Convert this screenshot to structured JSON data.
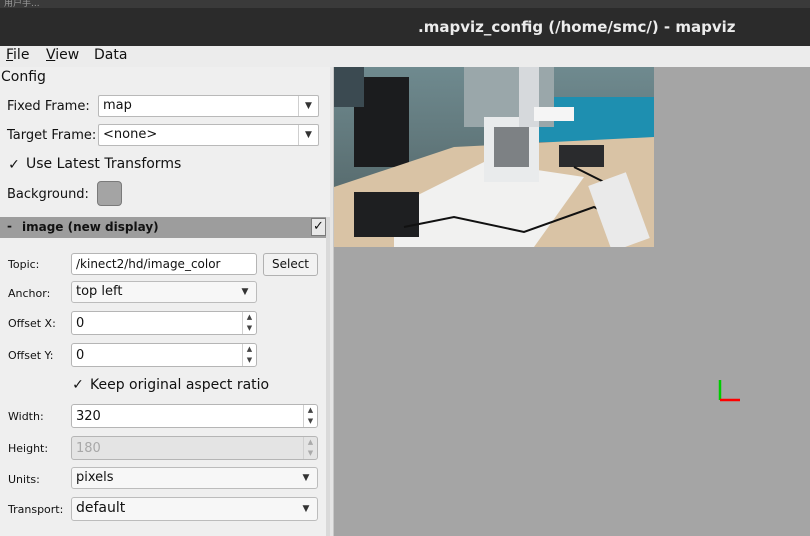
{
  "window": {
    "top_strip_text": "用户手...",
    "title": ".mapviz_config (/home/smc/) - mapviz"
  },
  "menu": [
    {
      "label": "File",
      "mnemonic": "F",
      "rest": "ile"
    },
    {
      "label": "View",
      "mnemonic": "V",
      "rest": "iew"
    },
    {
      "label": "Data",
      "mnemonic": "",
      "rest": "Data"
    }
  ],
  "config": {
    "title": "Config",
    "fixed_frame": {
      "label": "Fixed Frame:",
      "value": "map"
    },
    "target_frame": {
      "label": "Target Frame:",
      "value": "<none>"
    },
    "use_latest": {
      "label": "Use Latest Transforms",
      "checked": true
    },
    "background": {
      "label": "Background:",
      "color": "#a5a5a5"
    }
  },
  "display": {
    "dash": "-",
    "name": "image (new display)",
    "enabled": true,
    "topic": {
      "label": "Topic:",
      "value": "/kinect2/hd/image_color",
      "button": "Select"
    },
    "anchor": {
      "label": "Anchor:",
      "value": "top left"
    },
    "offset_x": {
      "label": "Offset X:",
      "value": "0"
    },
    "offset_y": {
      "label": "Offset Y:",
      "value": "0"
    },
    "keep_aspect": {
      "label": "Keep original aspect ratio",
      "checked": true
    },
    "width": {
      "label": "Width:",
      "value": "320"
    },
    "height": {
      "label": "Height:",
      "value": "180"
    },
    "units": {
      "label": "Units:",
      "value": "pixels"
    },
    "transport": {
      "label": "Transport:",
      "value": "default"
    }
  },
  "icons": {
    "check": "✓",
    "dropdown": "▼",
    "spin_up": "▲",
    "spin_down": "▼"
  },
  "colors": {
    "map_background": "#a5a5a5",
    "title_bar": "#2b2b2b",
    "axis_x": "#ff0000",
    "axis_y": "#00cc00"
  }
}
